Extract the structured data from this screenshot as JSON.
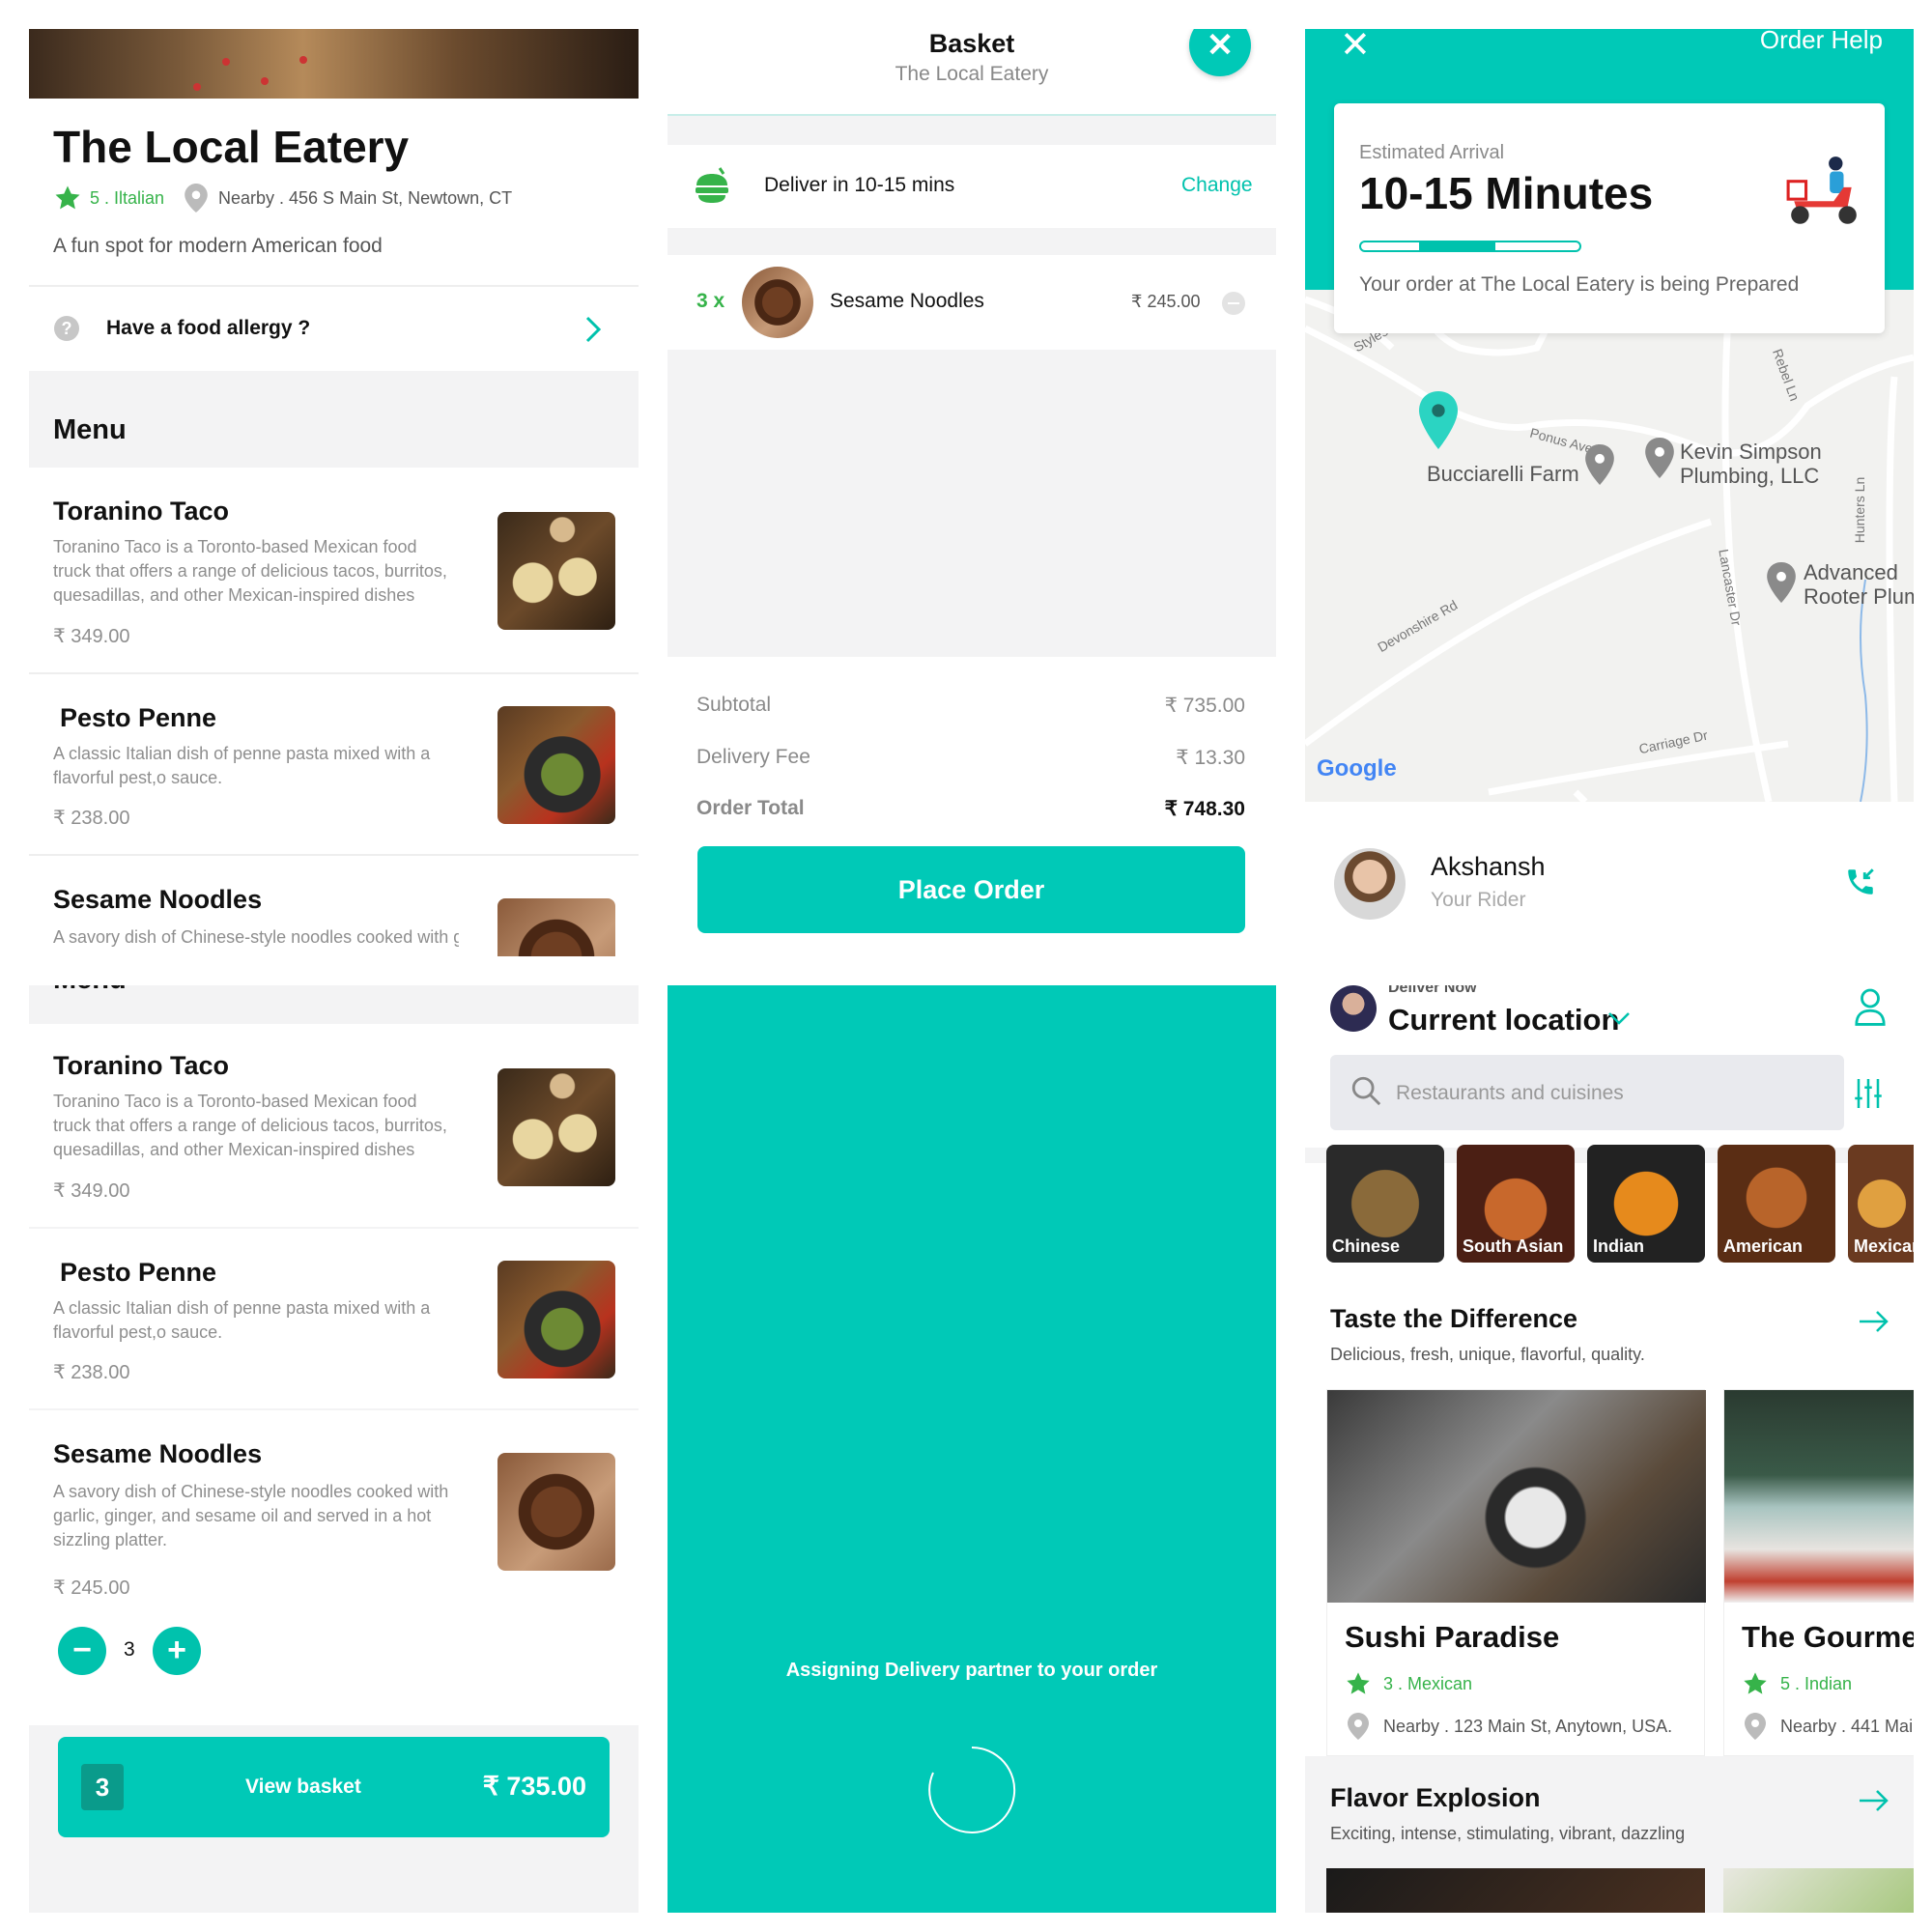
{
  "menu_screen": {
    "restaurant_name": "The Local Eatery",
    "rating": "5 . Iltalian",
    "location": "Nearby .  456 S Main St, Newtown, CT",
    "tagline": "A fun spot for modern American food",
    "allergy_label": "Have a food allergy ?",
    "menu_heading": "Menu",
    "items": [
      {
        "name": "Toranino Taco",
        "desc": "Toranino Taco is a Toronto-based Mexican food truck that offers a range of delicious tacos, burritos, quesadillas, and other Mexican-inspired dishes",
        "price": "₹ 349.00"
      },
      {
        "name": "Pesto Penne",
        "desc": "A classic Italian dish of penne pasta mixed with a flavorful pest,o sauce.",
        "price": "₹ 238.00"
      },
      {
        "name": "Sesame Noodles",
        "desc": "A savory dish of Chinese-style noodles cooked with garlic, ginger, and sesame oil and served in a hot sizzling platter.",
        "price": "₹ 245.00"
      }
    ]
  },
  "basket_screen": {
    "title": "Basket",
    "subtitle": "The Local Eatery",
    "close_icon": "close-icon",
    "deliver_text": "Deliver in 10-15 mins",
    "change_label": "Change",
    "line_item": {
      "qty": "3 x",
      "name": "Sesame Noodles",
      "price": "₹ 245.00"
    },
    "subtotal_label": "Subtotal",
    "subtotal_value": "₹ 735.00",
    "delivery_label": "Delivery Fee",
    "delivery_value": "₹ 13.30",
    "total_label": "Order Total",
    "total_value": "₹ 748.30",
    "place_order": "Place Order"
  },
  "tracking_screen": {
    "order_help": "Order Help",
    "eta_label": "Estimated Arrival",
    "eta_value": "10-15 Minutes",
    "eta_progress": 0.5,
    "status": "Your order at The Local Eatery is being Prepared",
    "map_labels": {
      "styles": "Styles L",
      "rebel": "Rebel Ln",
      "ponus": "Ponus Ave",
      "farm": "Bucciarelli Farm",
      "kevin1": "Kevin Simpson",
      "kevin2": "Plumbing, LLC",
      "hunters": "Hunters Ln",
      "lancaster": "Lancaster Dr",
      "devonshire": "Devonshire Rd",
      "advanced1": "Advanced",
      "advanced2": "Rooter Plum",
      "carriage": "Carriage Dr",
      "google": "Google"
    },
    "rider_name": "Akshansh",
    "rider_role": "Your Rider"
  },
  "menu_quantity_screen": {
    "menu_heading": "Menu",
    "quantity": "3",
    "basket_count": "3",
    "view_basket": "View basket",
    "basket_total": "₹ 735.00"
  },
  "assigning_screen": {
    "message": "Assigning Delivery partner to your order"
  },
  "home_screen": {
    "deliver_now": "Deliver Now",
    "location": "Current location",
    "search_placeholder": "Restaurants and cuisines",
    "categories": [
      "Chinese",
      "South Asian",
      "Indian",
      "American",
      "Mexican"
    ],
    "section1_title": "Taste the Difference",
    "section1_sub": "Delicious, fresh, unique, flavorful, quality.",
    "restaurants": [
      {
        "name": "Sushi Paradise",
        "rating": "3 . Mexican",
        "address": "Nearby . 123 Main St, Anytown, USA."
      },
      {
        "name": "The Gourmet",
        "rating": "5 . Indian",
        "address": "Nearby . 441 Mai"
      }
    ],
    "section2_title": "Flavor Explosion",
    "section2_sub": "Exciting, intense, stimulating, vibrant, dazzling"
  },
  "colors": {
    "accent": "#00c9b7",
    "rating": "#36b34a"
  }
}
